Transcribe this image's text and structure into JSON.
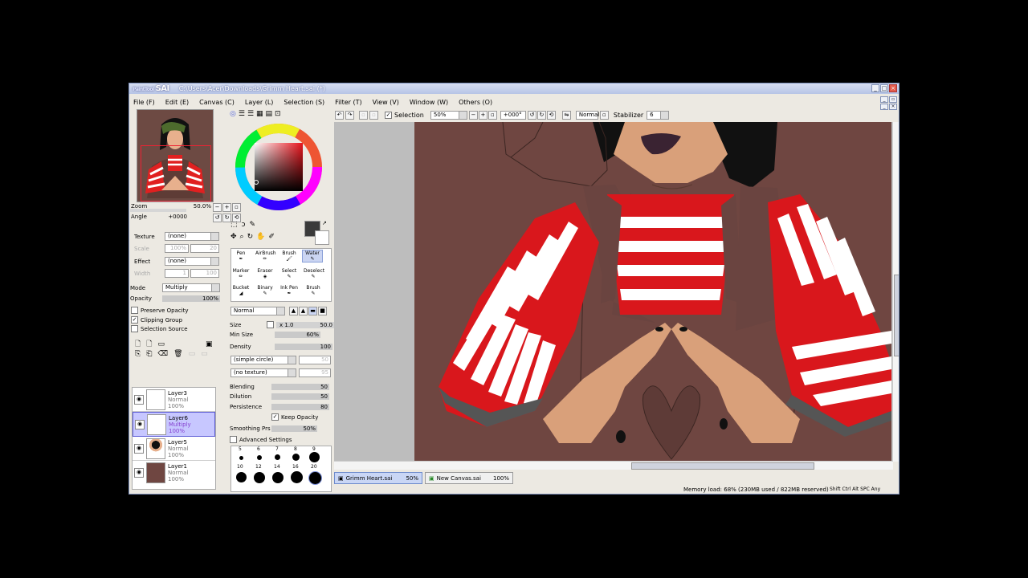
{
  "app": {
    "logo_small": "PaintTool",
    "logo": "SAI",
    "title": "C:\\Users\\Acer\\Downloads\\Grimm Heart.sai (*)"
  },
  "menu": [
    "File (F)",
    "Edit (E)",
    "Canvas (C)",
    "Layer (L)",
    "Selection (S)",
    "Filter (T)",
    "View (V)",
    "Window (W)",
    "Others (O)"
  ],
  "navigator": {
    "zoom_label": "Zoom",
    "zoom_value": "50.0%",
    "angle_label": "Angle",
    "angle_value": "+0000"
  },
  "layer_props": {
    "texture_label": "Texture",
    "texture_value": "(none)",
    "effect_label": "Effect",
    "effect_value": "(none)",
    "scale_label": "Scale",
    "scale_value": "100%",
    "scale_num": "20",
    "width_label": "Width",
    "width_num": "1",
    "width_val": "100",
    "mode_label": "Mode",
    "mode_value": "Multiply",
    "opacity_label": "Opacity",
    "opacity_value": "100%",
    "opacity_fill": 1.0,
    "preserve_opacity": "Preserve Opacity",
    "clipping_group": "Clipping Group",
    "selection_source": "Selection Source"
  },
  "layers": [
    {
      "name": "Layer3",
      "mode": "Normal",
      "opacity": "100%",
      "selected": false
    },
    {
      "name": "Layer6",
      "mode": "Multiply",
      "opacity": "100%",
      "selected": true
    },
    {
      "name": "Layer5",
      "mode": "Normal",
      "opacity": "100%",
      "selected": false
    },
    {
      "name": "Layer1",
      "mode": "Normal",
      "opacity": "100%",
      "selected": false
    }
  ],
  "tools": [
    {
      "label": "Pen",
      "active": false
    },
    {
      "label": "AirBrush",
      "active": false
    },
    {
      "label": "Brush",
      "active": false
    },
    {
      "label": "Water",
      "active": true
    },
    {
      "label": "Marker",
      "active": false
    },
    {
      "label": "Eraser",
      "active": false
    },
    {
      "label": "Select",
      "active": false
    },
    {
      "label": "Deselect",
      "active": false
    },
    {
      "label": "Bucket",
      "active": false
    },
    {
      "label": "Binary",
      "active": false
    },
    {
      "label": "Ink Pen",
      "active": false
    },
    {
      "label": "Brush",
      "active": false
    }
  ],
  "brush": {
    "blend_mode": "Normal",
    "size_label": "Size",
    "size_mult": "x 1.0",
    "size_value": "50.0",
    "min_size_label": "Min Size",
    "min_size_value": "60%",
    "density_label": "Density",
    "density_value": "100",
    "shape": "(simple circle)",
    "texture": "(no texture)",
    "shape_num": "50",
    "texture_num": "95",
    "blending_label": "Blending",
    "blending_value": "50",
    "dilution_label": "Dilution",
    "dilution_value": "50",
    "persistence_label": "Persistence",
    "persistence_value": "80",
    "keep_opacity": "Keep Opacity",
    "smoothing_label": "Smoothing Prs",
    "smoothing_value": "50%",
    "advanced": "Advanced Settings",
    "sizes_top": [
      "5",
      "6",
      "7",
      "8",
      "9"
    ],
    "sizes_bottom": [
      "10",
      "12",
      "14",
      "16",
      "20"
    ]
  },
  "canvas_toolbar": {
    "selection_label": "Selection",
    "zoom_value": "50%",
    "angle_value": "+000°",
    "mode_value": "Normal",
    "stabilizer_label": "Stabilizer",
    "stabilizer_value": "6"
  },
  "tabs": [
    {
      "name": "Grimm Heart.sai",
      "zoom": "50%",
      "active": true
    },
    {
      "name": "New Canvas.sai",
      "zoom": "100%",
      "active": false
    }
  ],
  "status": {
    "memory": "Memory load: 68% (230MB used / 822MB reserved)",
    "keys": "Shift Ctrl Alt SPC  Any"
  },
  "colors": {
    "canvas_bg": "#6f4641",
    "stripe_red": "#d9171c",
    "stripe_white": "#ffffff",
    "skin": "#d9a07a",
    "hair": "#111111",
    "selected_layer": "#c7c7ff",
    "titlebar": "#b6c4e6"
  }
}
